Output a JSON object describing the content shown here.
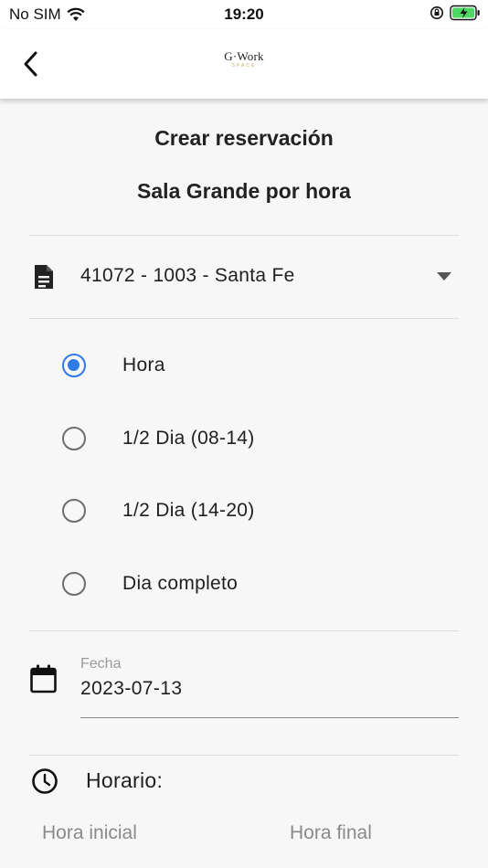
{
  "status_bar": {
    "carrier": "No SIM",
    "time": "19:20"
  },
  "app_bar": {
    "logo_main": "G·Work",
    "logo_sub": "SPACE"
  },
  "page": {
    "title": "Crear reservación",
    "subtitle": "Sala Grande por hora"
  },
  "account_select": {
    "value": "41072 - 1003 - Santa Fe"
  },
  "booking_type": {
    "options": [
      {
        "label": "Hora",
        "selected": true
      },
      {
        "label": "1/2 Dia (08-14)",
        "selected": false
      },
      {
        "label": "1/2 Dia (14-20)",
        "selected": false
      },
      {
        "label": "Dia completo",
        "selected": false
      }
    ]
  },
  "date_field": {
    "label": "Fecha",
    "value": "2023-07-13"
  },
  "schedule": {
    "label": "Horario:",
    "start_label": "Hora inicial",
    "end_label": "Hora final"
  },
  "colors": {
    "accent": "#2f7ae5",
    "battery": "#4cd964"
  },
  "icons": {
    "back": "chevron-left-icon",
    "document": "document-icon",
    "dropdown": "arrow-drop-down-icon",
    "calendar": "calendar-icon",
    "clock": "clock-icon"
  }
}
